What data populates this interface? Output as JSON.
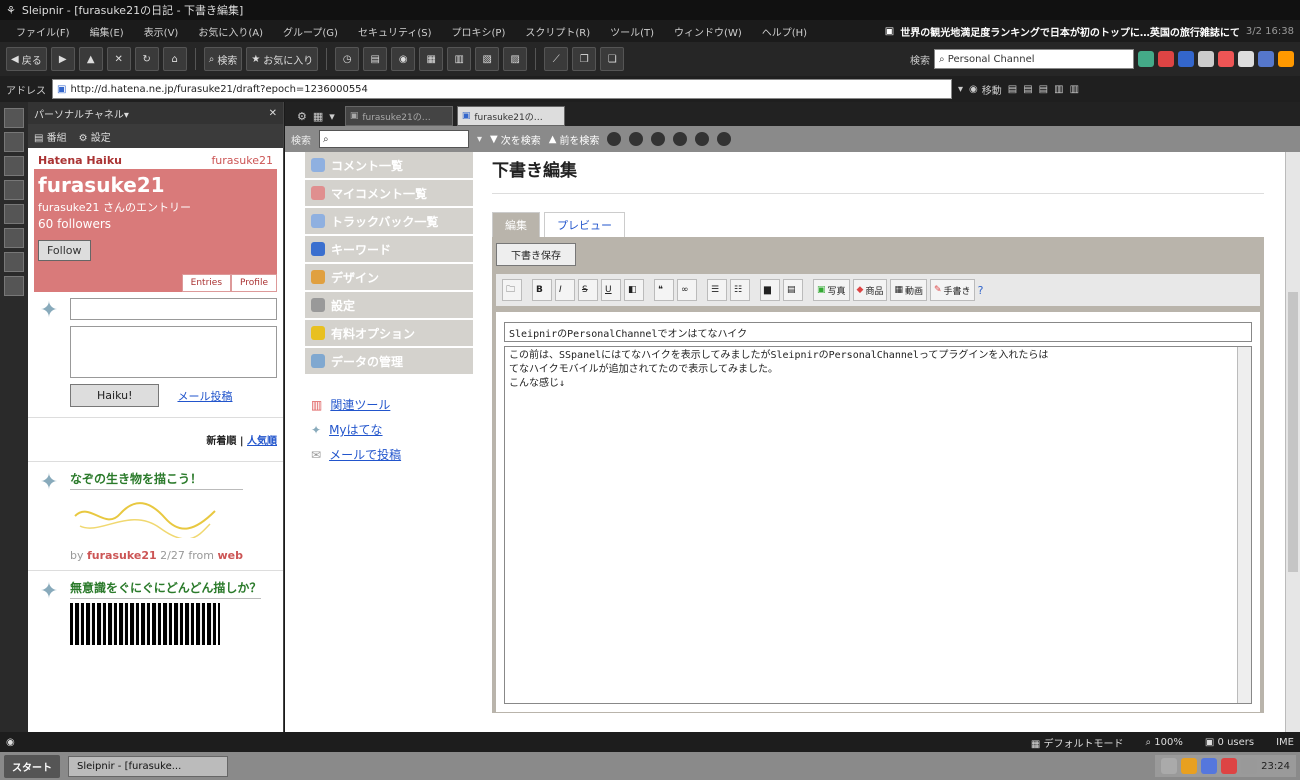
{
  "window": {
    "title": "Sleipnir - [furasuke21の日記 - 下書き編集]"
  },
  "menu": {
    "items": [
      "ファイル(F)",
      "編集(E)",
      "表示(V)",
      "お気に入り(A)",
      "グループ(G)",
      "セキュリティ(S)",
      "プロキシ(P)",
      "スクリプト(R)",
      "ツール(T)",
      "ウィンドウ(W)",
      "ヘルプ(H)"
    ],
    "news_headline": "世界の観光地満足度ランキングで日本が初のトップに…英国の旅行雑誌にて",
    "news_time": "3/2 16:38"
  },
  "toolbar": {
    "back_label": "戻る",
    "search_label": "検索",
    "favorites_label": "お気に入り",
    "search_engine_label": "検索",
    "search_value": "Personal Channel"
  },
  "address": {
    "label": "アドレス",
    "url": "http://d.hatena.ne.jp/furasuke21/draft?epoch=1236000554",
    "go_label": "移動"
  },
  "sidebar": {
    "panel_title": "パーソナルチャネル▾",
    "tool_1": "番組",
    "tool_2": "設定",
    "card": {
      "brand": "Hatena Haiku",
      "username_top": "furasuke21",
      "username": "furasuke21",
      "subtitle": "furasuke21 さんのエントリー",
      "followers": "60 followers",
      "follow_button": "Follow",
      "tab_entries": "Entries",
      "tab_profile": "Profile"
    },
    "post_button": "Haiku!",
    "mail_post_link": "メール投稿",
    "sort_new": "新着順",
    "sort_popular": "人気順",
    "entries": [
      {
        "title": "なぞの生き物を描こう！",
        "user": "furasuke21",
        "date": "2/27",
        "from": "from",
        "source": "web"
      },
      {
        "title": "無意識をぐにぐにどんどん描しか？"
      }
    ]
  },
  "tabs": {
    "items": [
      "furasuke21の…",
      "furasuke21の…"
    ]
  },
  "findbar": {
    "label": "検索",
    "next_label": "次を検索",
    "prev_label": "前を検索"
  },
  "leftnav": {
    "items": [
      "コメント一覧",
      "マイコメント一覧",
      "トラックバック一覧",
      "キーワード",
      "デザイン",
      "設定",
      "有料オプション",
      "データの管理"
    ],
    "colors": [
      "#8fb0e0",
      "#e08f8f",
      "#8fb0e0",
      "#3a6fcf",
      "#e0a040",
      "#999999",
      "#e8c020",
      "#80a8d0"
    ],
    "links": [
      "関連ツール",
      "Myはてな",
      "メールで投稿"
    ]
  },
  "editor": {
    "page_title": "下書き編集",
    "tab_edit": "編集",
    "tab_preview": "プレビュー",
    "save_draft": "下書き保存",
    "fmt_photo": "写真",
    "fmt_product": "商品",
    "fmt_video": "動画",
    "fmt_handwriting": "手書き",
    "title_value": "SleipnirのPersonalChannelでオンはてなハイク",
    "body_lines": [
      "この前は、SSpanelにはてなハイクを表示してみましたがSleipnirのPersonalChannelってプラグインを入れたらは",
      "てなハイクモバイルが追加されてたので表示してみました。",
      "こんな感じ↓"
    ]
  },
  "status": {
    "mode": "デフォルトモード",
    "zoom": "100%",
    "users": "0 users",
    "right": "IME"
  },
  "taskbar": {
    "start": "スタート",
    "task": "Sleipnir - [furasuke...",
    "clock": "23:24"
  }
}
